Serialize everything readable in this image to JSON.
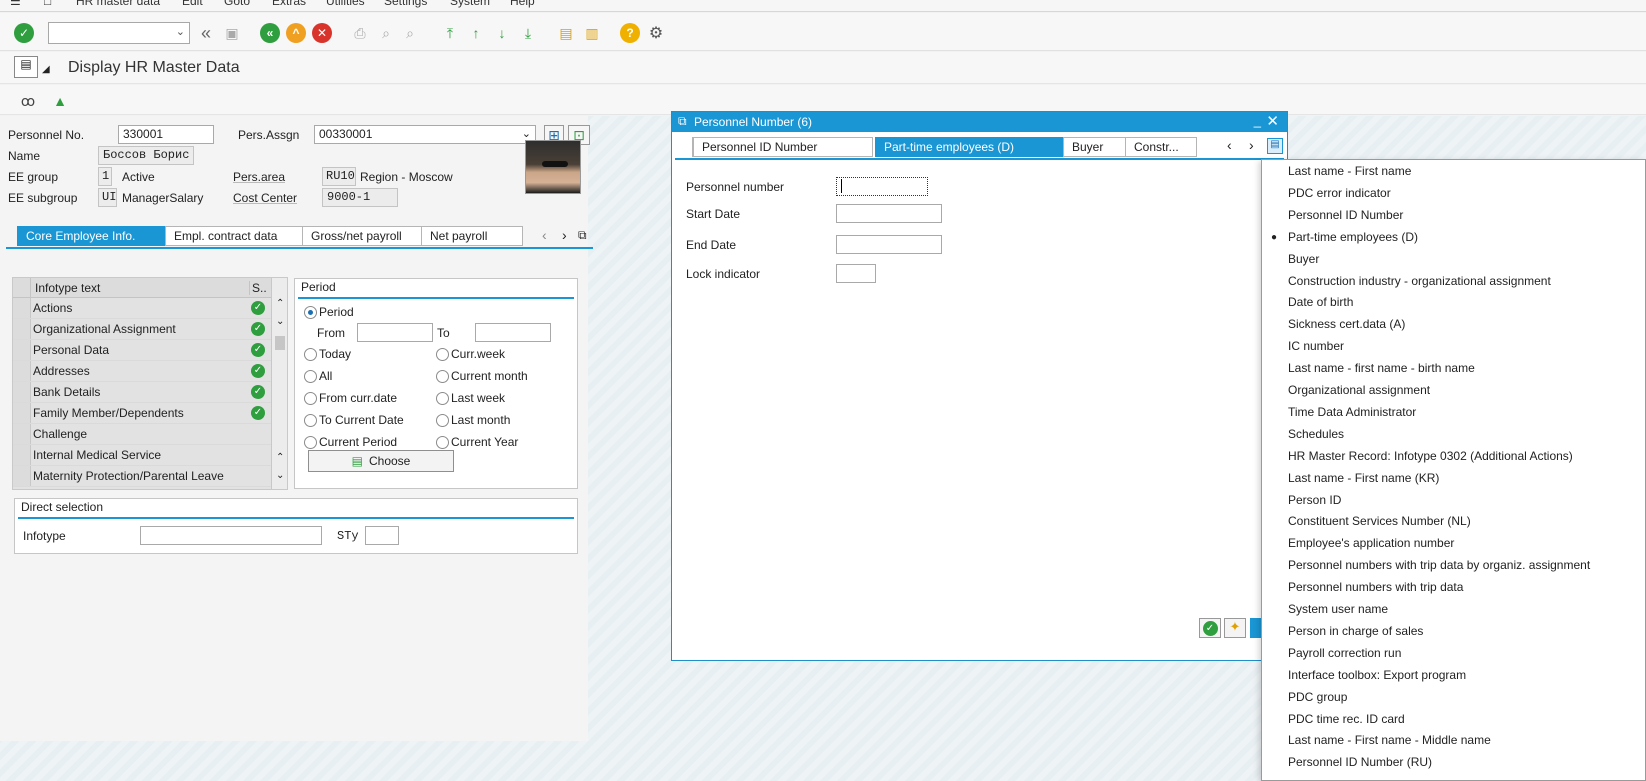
{
  "menu": {
    "items": [
      "HR master data",
      "Edit",
      "Goto",
      "Extras",
      "Utilities",
      "Settings",
      "System",
      "Help"
    ]
  },
  "header": {
    "title": "Display HR Master Data"
  },
  "employee": {
    "personnel_no_label": "Personnel No.",
    "personnel_no": "330001",
    "pers_assgn_label": "Pers.Assgn",
    "pers_assgn": "00330001",
    "name_label": "Name",
    "name": "Боссов Борис",
    "ee_group_label": "EE group",
    "ee_group_code": "1",
    "ee_group_text": "Active",
    "pers_area_label": "Pers.area",
    "pers_area_code": "RU10",
    "pers_area_text": "Region - Moscow",
    "ee_subgroup_label": "EE subgroup",
    "ee_subgroup_code": "UI",
    "ee_subgroup_text": "ManagerSalary",
    "cost_center_label": "Cost Center",
    "cost_center": "9000-1"
  },
  "tabs": [
    {
      "label": "Core Employee Info."
    },
    {
      "label": "Empl. contract data"
    },
    {
      "label": "Gross/net payroll"
    },
    {
      "label": "Net payroll"
    }
  ],
  "infotypes": {
    "col_text": "Infotype text",
    "col_status": "S..",
    "rows": [
      {
        "text": "Actions",
        "done": true
      },
      {
        "text": "Organizational Assignment",
        "done": true
      },
      {
        "text": "Personal Data",
        "done": true
      },
      {
        "text": "Addresses",
        "done": true
      },
      {
        "text": "Bank Details",
        "done": true
      },
      {
        "text": "Family Member/Dependents",
        "done": true
      },
      {
        "text": "Challenge",
        "done": false
      },
      {
        "text": "Internal Medical Service",
        "done": false
      },
      {
        "text": "Maternity Protection/Parental Leave",
        "done": false
      }
    ]
  },
  "period": {
    "title": "Period",
    "period_option": "Period",
    "from_label": "From",
    "to_label": "To",
    "options_left": [
      "Today",
      "All",
      "From curr.date",
      "To Current Date",
      "Current Period"
    ],
    "options_right": [
      "Curr.week",
      "Current month",
      "Last week",
      "Last month",
      "Current Year"
    ],
    "choose_label": "Choose"
  },
  "direct_selection": {
    "title": "Direct selection",
    "infotype_label": "Infotype",
    "sty_label": "STy"
  },
  "dialog": {
    "title": "Personnel Number (6)",
    "tabs": [
      "Personnel ID Number",
      "Part-time employees (D)",
      "Buyer",
      "Constr..."
    ],
    "fields": {
      "personnel_number": "Personnel number",
      "start_date": "Start Date",
      "end_date": "End Date",
      "lock_indicator": "Lock indicator"
    }
  },
  "dropdown": {
    "selected": "Part-time employees (D)",
    "items": [
      "Last name - First name",
      "PDC error indicator",
      "Personnel ID Number",
      "Part-time employees (D)",
      "Buyer",
      "Construction industry - organizational assignment",
      "Date of birth",
      "Sickness cert.data (A)",
      "IC number",
      "Last name - first name - birth name",
      "Organizational assignment",
      "Time Data Administrator",
      "Schedules",
      "HR Master Record: Infotype 0302 (Additional Actions)",
      "Last name - First name (KR)",
      "Person ID",
      "Constituent Services Number (NL)",
      "Employee's application number",
      "Personnel numbers with trip data by organiz. assignment",
      "Personnel numbers with trip data",
      "System user name",
      "Person in charge of sales",
      "Payroll correction run",
      "Interface toolbox: Export program",
      "PDC group",
      "PDC time rec. ID card",
      "Last name - First name - Middle name",
      "Personnel ID Number (RU)"
    ]
  },
  "colors": {
    "accent": "#1a96d4",
    "ok_green": "#2f9e3f",
    "cancel_red": "#d9342b",
    "back_orange": "#f0a020"
  }
}
